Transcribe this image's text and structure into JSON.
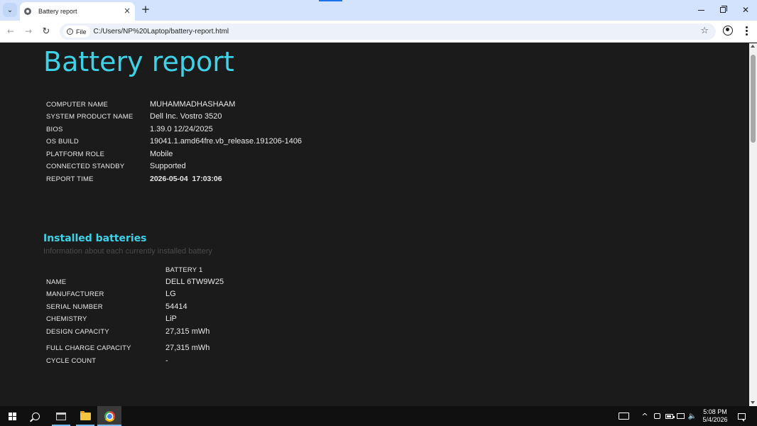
{
  "browser": {
    "tab_title": "Battery report",
    "tab_close": "×",
    "new_tab": "+",
    "address_chip": "File",
    "url": "C:/Users/NP%20Laptop/battery-report.html",
    "info_icon": "i",
    "back_icon": "←",
    "forward_icon": "→",
    "reload_icon": "↻",
    "star_icon": "☆",
    "tab_search_icon": "⌄",
    "close_window_icon": "✕"
  },
  "report": {
    "title": "Battery report",
    "system_info": [
      {
        "label": "COMPUTER NAME",
        "value": "MUHAMMADHASHAAM"
      },
      {
        "label": "SYSTEM PRODUCT NAME",
        "value": "Dell Inc. Vostro 3520"
      },
      {
        "label": "BIOS",
        "value": "1.39.0 12/24/2025"
      },
      {
        "label": "OS BUILD",
        "value": "19041.1.amd64fre.vb_release.191206-1406"
      },
      {
        "label": "PLATFORM ROLE",
        "value": "Mobile"
      },
      {
        "label": "CONNECTED STANDBY",
        "value": "Supported"
      },
      {
        "label": "REPORT TIME",
        "value": "2026-05-04  17:03:06"
      }
    ],
    "installed_batteries": {
      "title": "Installed batteries",
      "subtitle": "Information about each currently installed battery",
      "column_header": "BATTERY 1",
      "rows": [
        {
          "label": "NAME",
          "value": "DELL 6TW9W25"
        },
        {
          "label": "MANUFACTURER",
          "value": "LG"
        },
        {
          "label": "SERIAL NUMBER",
          "value": "54414"
        },
        {
          "label": "CHEMISTRY",
          "value": "LiP"
        },
        {
          "label": "DESIGN CAPACITY",
          "value": "27,315 mWh"
        },
        {
          "label": "FULL CHARGE CAPACITY",
          "value": "27,315 mWh"
        },
        {
          "label": "CYCLE COUNT",
          "value": "-"
        }
      ]
    }
  },
  "taskbar": {
    "time": "5:08 PM",
    "date": "5/4/2026",
    "tray_chevron": "^",
    "volume_icon": "🔈"
  },
  "colors": {
    "accent": "#3fd1e6",
    "page_background": "#1b1b1c",
    "tabstrip": "#d3e3fd",
    "taskbar": "#101010"
  }
}
